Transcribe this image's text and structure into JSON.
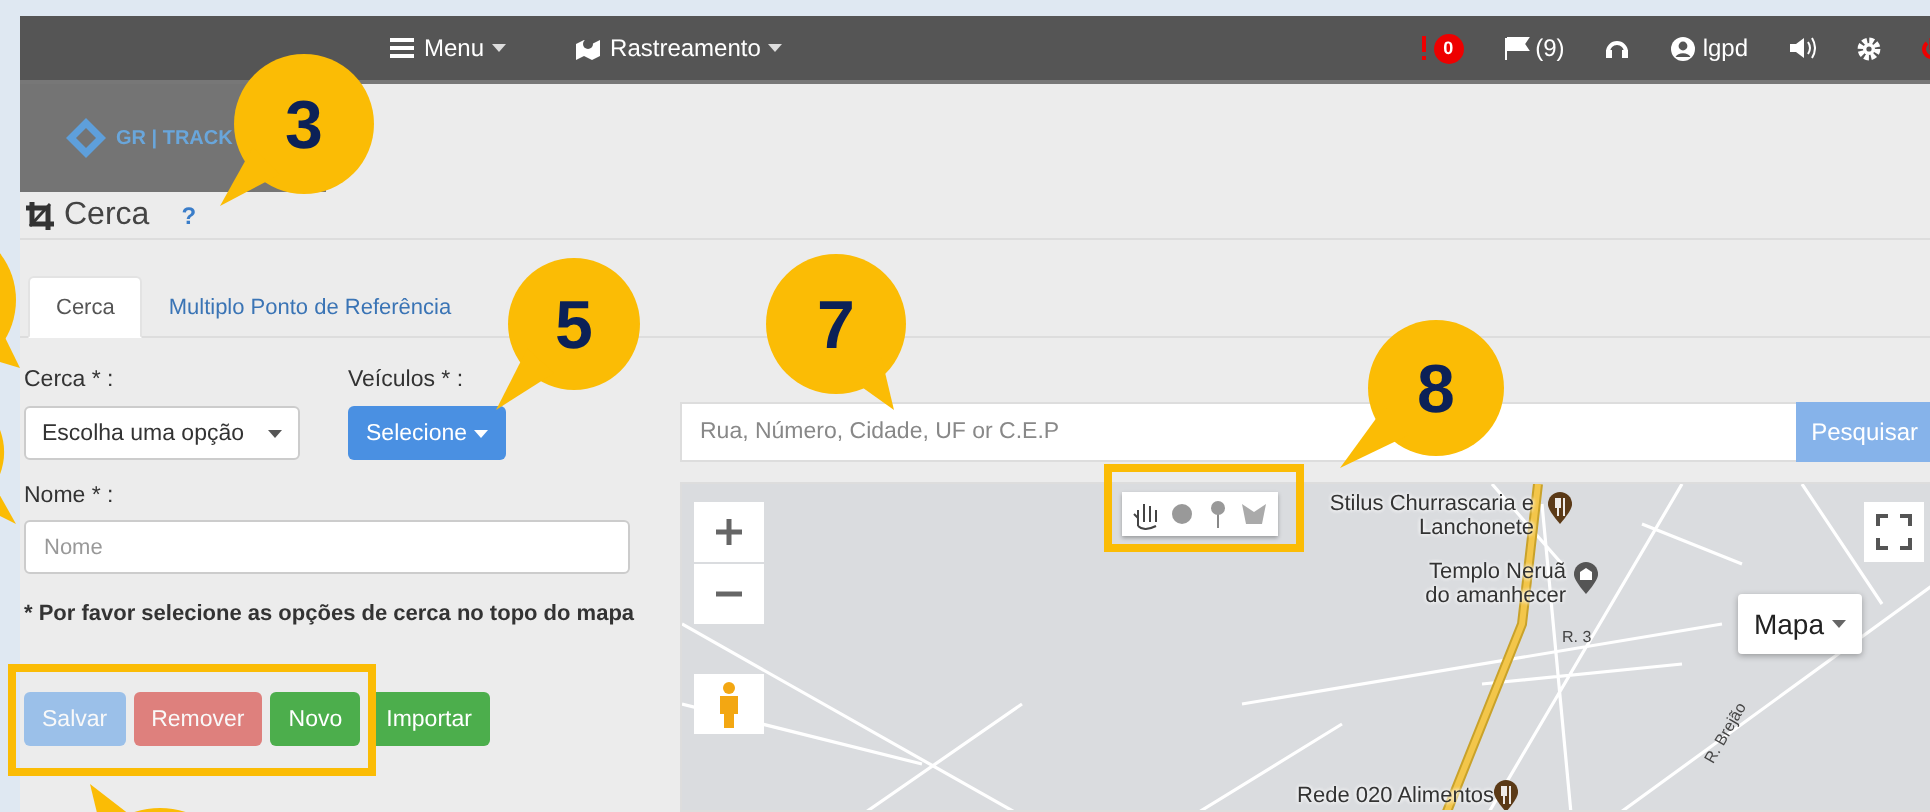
{
  "top_bar": {
    "menus": [
      {
        "label": "Menu",
        "kind": "menu"
      },
      {
        "label": "Rastreamento",
        "kind": "tracking"
      }
    ],
    "alert_count": "0",
    "flag_count": "(9)",
    "user": "lgpd"
  },
  "logo": {
    "text": "GR | TRACK"
  },
  "header": {
    "title": "Cerca",
    "help": "?"
  },
  "tabs": [
    {
      "label": "Cerca",
      "selected": true
    },
    {
      "label": "Multiplo Ponto de Referência",
      "selected": false
    }
  ],
  "form": {
    "fence_label": "Cerca * :",
    "fence_select": "Escolha uma opção",
    "vehicles_label": "Veículos * :",
    "vehicles_button": "Selecione",
    "name_label": "Nome * :",
    "name_placeholder": "Nome",
    "note": "* Por favor selecione as opções de cerca no topo do mapa",
    "buttons": [
      {
        "label": "Salvar",
        "kind": "primary",
        "disabled": true
      },
      {
        "label": "Remover",
        "kind": "danger",
        "disabled": true
      },
      {
        "label": "Novo",
        "kind": "success",
        "disabled": false
      },
      {
        "label": "Importar",
        "kind": "success",
        "disabled": false
      }
    ]
  },
  "search": {
    "placeholder": "Rua, Número, Cidade, UF or C.E.P",
    "button": "Pesquisar"
  },
  "map": {
    "map_type": "Mapa",
    "places": [
      {
        "name": "Stilus Churrascaria e Lanchonete",
        "kind": "restaurant"
      },
      {
        "name": "Templo Neruã do amanhecer",
        "kind": "temple"
      },
      {
        "name": "Rede 020 Alimentos",
        "kind": "restaurant"
      }
    ],
    "streets": [
      "R. 3",
      "R. Brejão"
    ]
  },
  "callouts": [
    {
      "label": "3"
    },
    {
      "label": "5"
    },
    {
      "label": "7"
    },
    {
      "label": "8"
    }
  ]
}
